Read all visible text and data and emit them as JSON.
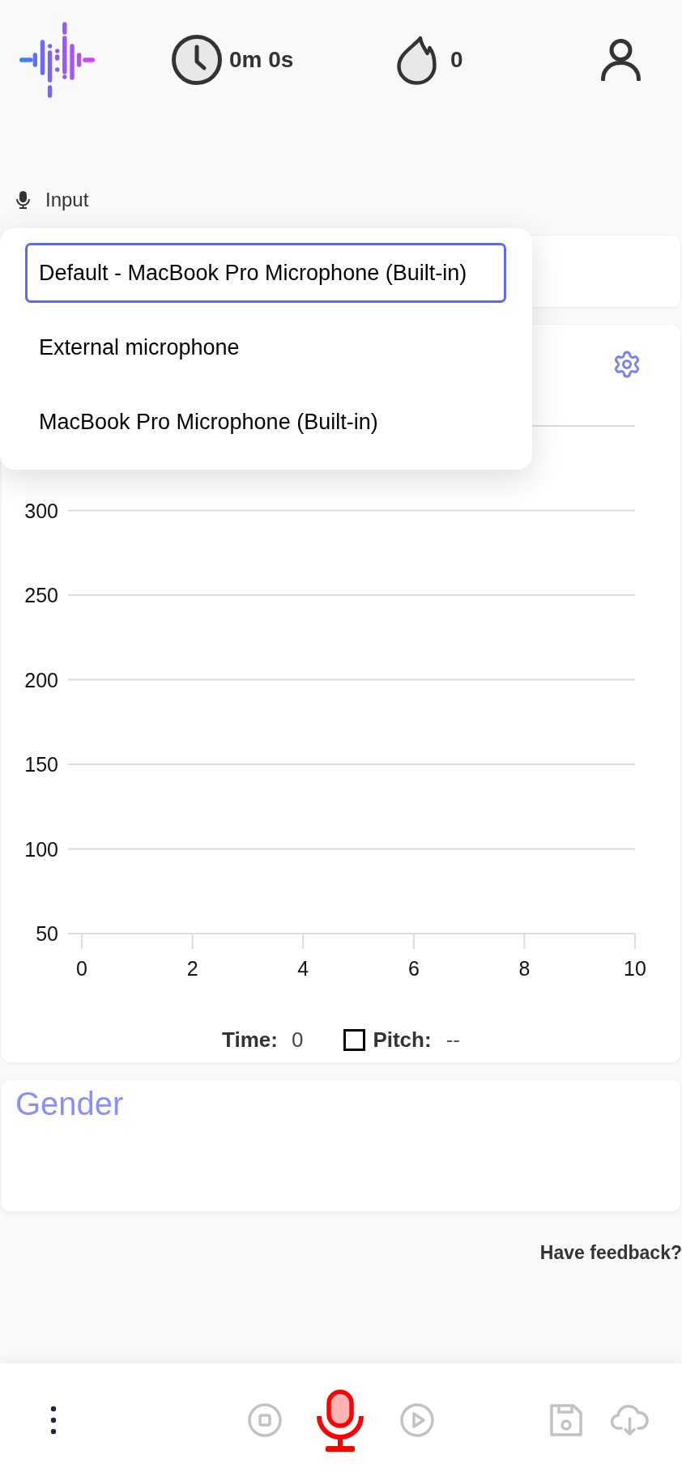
{
  "header": {
    "timer": "0m 0s",
    "streak": "0"
  },
  "input": {
    "label": "Input",
    "options": [
      {
        "label": "Default - MacBook Pro Microphone (Built-in)",
        "selected": true
      },
      {
        "label": "External microphone",
        "selected": false
      },
      {
        "label": "MacBook Pro Microphone (Built-in)",
        "selected": false
      }
    ]
  },
  "pitch_chart": {
    "chart_data": {
      "type": "line",
      "xticks": [
        0,
        2,
        4,
        6,
        8,
        10
      ],
      "yticks": [
        50,
        100,
        150,
        200,
        250,
        300
      ],
      "xlim": [
        -0.25,
        10
      ],
      "ylim": [
        50,
        350
      ],
      "grid": true
    },
    "time_label": "Time:",
    "time_value": "0",
    "pitch_checkbox": {
      "checked": false
    },
    "pitch_label": "Pitch:",
    "pitch_value": "--"
  },
  "gender": {
    "title": "Gender"
  },
  "feedback_link": "Have feedback?"
}
